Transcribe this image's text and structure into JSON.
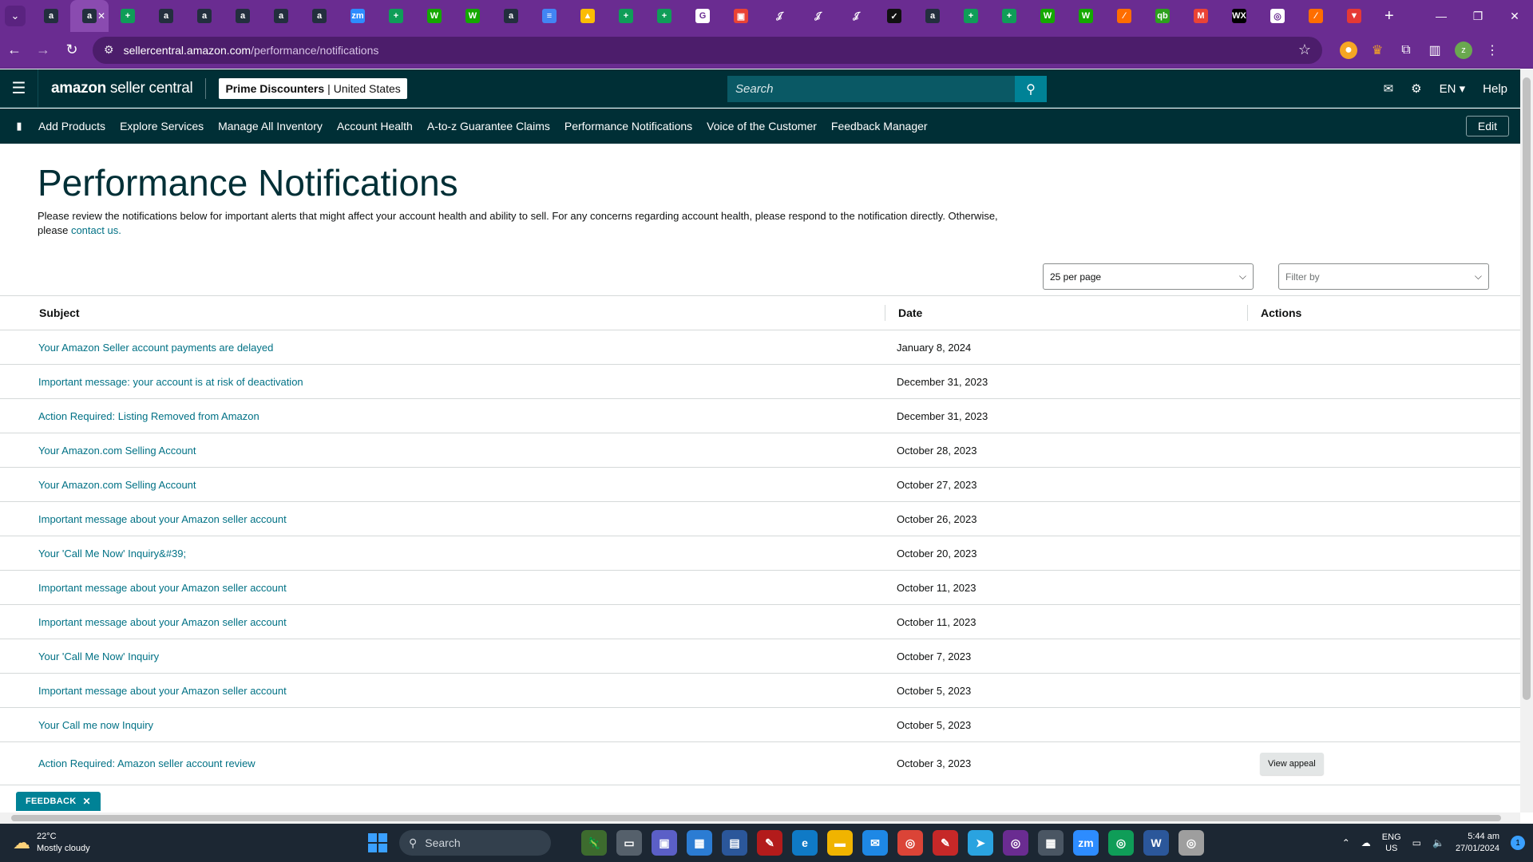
{
  "browser": {
    "tabs": [
      {
        "icon": "amazon-icon",
        "color": "#232f3e",
        "glyph": "a"
      },
      {
        "icon": "amazon-icon",
        "color": "#232f3e",
        "glyph": "a",
        "active": true
      },
      {
        "icon": "sheets-icon",
        "color": "#0f9d58",
        "glyph": "+"
      },
      {
        "icon": "amazon-icon",
        "color": "#232f3e",
        "glyph": "a"
      },
      {
        "icon": "amazon-icon",
        "color": "#232f3e",
        "glyph": "a"
      },
      {
        "icon": "amazon-icon",
        "color": "#232f3e",
        "glyph": "a"
      },
      {
        "icon": "amazon-icon",
        "color": "#232f3e",
        "glyph": "a"
      },
      {
        "icon": "amazon-icon",
        "color": "#232f3e",
        "glyph": "a"
      },
      {
        "icon": "zoom-icon",
        "color": "#2d8cff",
        "glyph": "zm"
      },
      {
        "icon": "sheets-icon",
        "color": "#0f9d58",
        "glyph": "+"
      },
      {
        "icon": "upwork-icon",
        "color": "#14a800",
        "glyph": "W"
      },
      {
        "icon": "upwork-icon",
        "color": "#14a800",
        "glyph": "W"
      },
      {
        "icon": "amazon-icon",
        "color": "#232f3e",
        "glyph": "a"
      },
      {
        "icon": "list-icon",
        "color": "#4285f4",
        "glyph": "≡"
      },
      {
        "icon": "drive-icon",
        "color": "#fbbc04",
        "glyph": "▲"
      },
      {
        "icon": "sheets-icon",
        "color": "#0f9d58",
        "glyph": "+"
      },
      {
        "icon": "sheets-icon",
        "color": "#0f9d58",
        "glyph": "+"
      },
      {
        "icon": "google-icon",
        "color": "#ffffff",
        "glyph": "G"
      },
      {
        "icon": "app-icon",
        "color": "#e94335",
        "glyph": "▣"
      },
      {
        "icon": "script-icon",
        "color": "#6a2c91",
        "glyph": "𝒥"
      },
      {
        "icon": "script-icon",
        "color": "#6a2c91",
        "glyph": "𝒥"
      },
      {
        "icon": "script-icon",
        "color": "#6a2c91",
        "glyph": "𝒥"
      },
      {
        "icon": "app-icon",
        "color": "#111111",
        "glyph": "✓"
      },
      {
        "icon": "amazon-icon",
        "color": "#232f3e",
        "glyph": "a"
      },
      {
        "icon": "sheets-icon",
        "color": "#0f9d58",
        "glyph": "+"
      },
      {
        "icon": "sheets-icon",
        "color": "#0f9d58",
        "glyph": "+"
      },
      {
        "icon": "upwork-icon",
        "color": "#14a800",
        "glyph": "W"
      },
      {
        "icon": "upwork-icon",
        "color": "#14a800",
        "glyph": "W"
      },
      {
        "icon": "app-icon",
        "color": "#ff6d00",
        "glyph": "⁄"
      },
      {
        "icon": "app-icon",
        "color": "#2ca01c",
        "glyph": "qb"
      },
      {
        "icon": "gmail-icon",
        "color": "#ea4335",
        "glyph": "M"
      },
      {
        "icon": "wix-icon",
        "color": "#000000",
        "glyph": "WX"
      },
      {
        "icon": "chrome-icon",
        "color": "#ffffff",
        "glyph": "◎"
      },
      {
        "icon": "app-icon",
        "color": "#ff6d00",
        "glyph": "⁄"
      },
      {
        "icon": "app-icon",
        "color": "#e53935",
        "glyph": "▼"
      }
    ],
    "url_host": "sellercentral.amazon.com",
    "url_path": "/performance/notifications"
  },
  "header": {
    "logo_bold": "amazon",
    "logo_rest": " seller central",
    "store_name": "Prime Discounters",
    "store_region": "United States",
    "search_placeholder": "Search",
    "language": "EN",
    "help": "Help"
  },
  "nav": {
    "items": [
      "Add Products",
      "Explore Services",
      "Manage All Inventory",
      "Account Health",
      "A-to-z Guarantee Claims",
      "Performance Notifications",
      "Voice of the Customer",
      "Feedback Manager"
    ],
    "edit": "Edit"
  },
  "page": {
    "title": "Performance Notifications",
    "intro": "Please review the notifications below for important alerts that might affect your account health and ability to sell. For any concerns regarding account health, please respond to the notification directly. Otherwise, please",
    "contact_link": "contact us.",
    "per_page": "25 per page",
    "filter_placeholder": "Filter by"
  },
  "table": {
    "headers": {
      "subject": "Subject",
      "date": "Date",
      "actions": "Actions"
    },
    "rows": [
      {
        "subject": "Your Amazon Seller account payments are delayed",
        "date": "January 8, 2024",
        "action": ""
      },
      {
        "subject": "Important message: your account is at risk of deactivation",
        "date": "December 31, 2023",
        "action": ""
      },
      {
        "subject": "Action Required: Listing Removed from Amazon",
        "date": "December 31, 2023",
        "action": ""
      },
      {
        "subject": "Your Amazon.com Selling Account",
        "date": "October 28, 2023",
        "action": ""
      },
      {
        "subject": "Your Amazon.com Selling Account",
        "date": "October 27, 2023",
        "action": ""
      },
      {
        "subject": "Important message about your Amazon seller account",
        "date": "October 26, 2023",
        "action": ""
      },
      {
        "subject": "Your 'Call Me Now' Inquiry&#39;",
        "date": "October 20, 2023",
        "action": ""
      },
      {
        "subject": "Important message about your Amazon seller account",
        "date": "October 11, 2023",
        "action": ""
      },
      {
        "subject": "Important message about your Amazon seller account",
        "date": "October 11, 2023",
        "action": ""
      },
      {
        "subject": "Your 'Call Me Now' Inquiry",
        "date": "October 7, 2023",
        "action": ""
      },
      {
        "subject": "Important message about your Amazon seller account",
        "date": "October 5, 2023",
        "action": ""
      },
      {
        "subject": "Your Call me now Inquiry",
        "date": "October 5, 2023",
        "action": ""
      },
      {
        "subject": "Action Required: Amazon seller account review",
        "date": "October 3, 2023",
        "action": "View appeal"
      }
    ]
  },
  "feedback": "FEEDBACK",
  "taskbar": {
    "temp": "22°C",
    "weather": "Mostly cloudy",
    "search": "Search",
    "lang_top": "ENG",
    "lang_bottom": "US",
    "time": "5:44 am",
    "date": "27/01/2024",
    "notifications": "1",
    "apps": [
      {
        "icon": "chameleon-icon",
        "color": "#3d6b2e",
        "glyph": "🦎"
      },
      {
        "icon": "taskview-icon",
        "color": "#55606b",
        "glyph": "▭"
      },
      {
        "icon": "teams-icon",
        "color": "#5b5fc7",
        "glyph": "▣"
      },
      {
        "icon": "store-icon",
        "color": "#2b7cd3",
        "glyph": "▦"
      },
      {
        "icon": "app-icon",
        "color": "#2b579a",
        "glyph": "▤"
      },
      {
        "icon": "app-icon",
        "color": "#b31b1b",
        "glyph": "✎"
      },
      {
        "icon": "edge-icon",
        "color": "#0f7ac6",
        "glyph": "e"
      },
      {
        "icon": "folder-icon",
        "color": "#f0b400",
        "glyph": "▬"
      },
      {
        "icon": "mail-icon",
        "color": "#1e88e5",
        "glyph": "✉"
      },
      {
        "icon": "chrome-icon",
        "color": "#db4437",
        "glyph": "◎"
      },
      {
        "icon": "app-icon",
        "color": "#c62828",
        "glyph": "✎"
      },
      {
        "icon": "telegram-icon",
        "color": "#2aa3e0",
        "glyph": "➤"
      },
      {
        "icon": "chrome-icon",
        "color": "#6a2c91",
        "glyph": "◎"
      },
      {
        "icon": "calculator-icon",
        "color": "#4a5663",
        "glyph": "▦"
      },
      {
        "icon": "zoom-icon",
        "color": "#2d8cff",
        "glyph": "zm"
      },
      {
        "icon": "chrome-icon",
        "color": "#0f9d58",
        "glyph": "◎"
      },
      {
        "icon": "word-icon",
        "color": "#2b579a",
        "glyph": "W"
      },
      {
        "icon": "chrome-icon",
        "color": "#9e9e9e",
        "glyph": "◎"
      }
    ]
  }
}
